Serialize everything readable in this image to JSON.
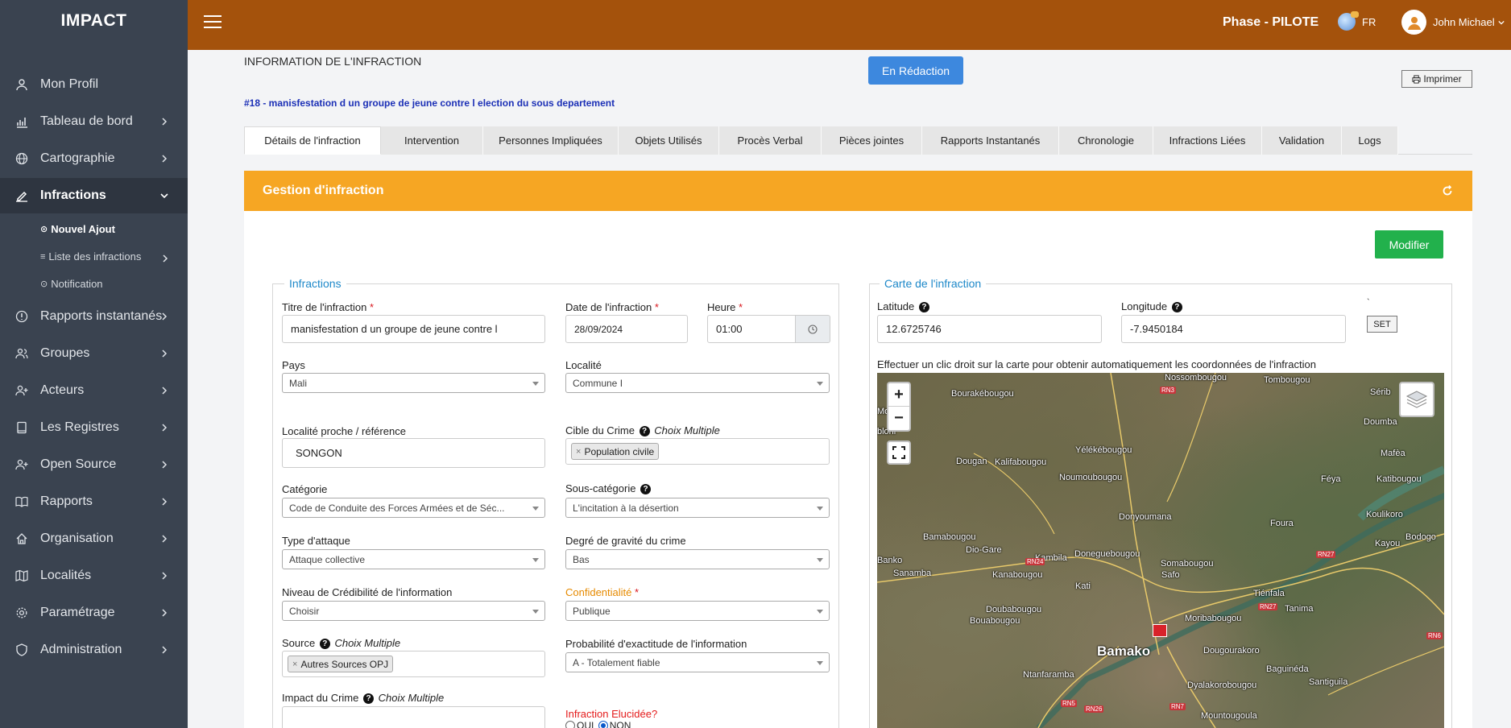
{
  "app": {
    "brand": "IMPACT"
  },
  "sidebar": {
    "items": [
      {
        "label": "Mon Profil",
        "icon": "user-icon",
        "chevron": false
      },
      {
        "label": "Tableau de bord",
        "icon": "bar-chart-icon",
        "chevron": true
      },
      {
        "label": "Cartographie",
        "icon": "globe-icon",
        "chevron": true
      },
      {
        "label": "Infractions",
        "icon": "edit-icon",
        "chevron": true,
        "active": true
      },
      {
        "label": "Rapports instantanés",
        "icon": "alert-circle-icon",
        "chevron": true
      },
      {
        "label": "Groupes",
        "icon": "users-icon",
        "chevron": true
      },
      {
        "label": "Acteurs",
        "icon": "user-plus-icon",
        "chevron": true
      },
      {
        "label": "Les Registres",
        "icon": "book-icon",
        "chevron": true
      },
      {
        "label": "Open Source",
        "icon": "user-plus-icon",
        "chevron": true
      },
      {
        "label": "Rapports",
        "icon": "open-book-icon",
        "chevron": true
      },
      {
        "label": "Organisation",
        "icon": "home-icon",
        "chevron": true
      },
      {
        "label": "Localités",
        "icon": "map-icon",
        "chevron": true
      },
      {
        "label": "Paramétrage",
        "icon": "gear-icon",
        "chevron": true
      },
      {
        "label": "Administration",
        "icon": "shield-icon",
        "chevron": true
      }
    ],
    "subitems": [
      {
        "label": "Nouvel Ajout",
        "icon": "⊙"
      },
      {
        "label": "Liste des infractions",
        "icon": "≡"
      },
      {
        "label": "Notification",
        "icon": "⊙"
      }
    ]
  },
  "topbar": {
    "phase": "Phase - PILOTE",
    "lang": "FR",
    "user": "John Michael"
  },
  "page": {
    "section_title": "INFORMATION DE L'INFRACTION",
    "status_button": "En Rédaction",
    "print_button": "Imprimer",
    "reference": "#18 - manisfestation d un groupe de jeune contre l election du sous departement"
  },
  "tabs": [
    "Détails de l'infraction",
    "Intervention",
    "Personnes Impliquées",
    "Objets Utilisés",
    "Procès Verbal",
    "Pièces jointes",
    "Rapports Instantanés",
    "Chronologie",
    "Infractions Liées",
    "Validation",
    "Logs"
  ],
  "panel": {
    "title": "Gestion d'infraction",
    "modify_button": "Modifier"
  },
  "form": {
    "legend": "Infractions",
    "titre_label": "Titre de l'infraction",
    "titre_value": "manisfestation d un groupe de jeune contre l",
    "date_label": "Date de l'infraction",
    "date_value": "28/09/2024",
    "heure_label": "Heure",
    "heure_value": "01:00",
    "pays_label": "Pays",
    "pays_value": "Mali",
    "localite_label": "Localité",
    "localite_value": "Commune I",
    "proche_label": "Localité proche / référence",
    "proche_value": "SONGON",
    "cible_label": "Cible du Crime",
    "multiple": "Choix Multiple",
    "cible_tag": "Population civile",
    "categorie_label": "Catégorie",
    "categorie_value": "Code de Conduite des Forces Armées et de Séc...",
    "souscat_label": "Sous-catégorie",
    "souscat_value": "L'incitation à la désertion",
    "attaque_label": "Type d'attaque",
    "attaque_value": "Attaque collective",
    "gravite_label": "Degré de gravité du crime",
    "gravite_value": "Bas",
    "credibilite_label": "Niveau de Crédibilité de l'information",
    "credibilite_value": "Choisir",
    "confidentialite_label": "Confidentialité",
    "confidentialite_value": "Publique",
    "source_label": "Source",
    "source_tag": "Autres Sources OPJ",
    "probabilite_label": "Probabilité d'exactitude de l'information",
    "probabilite_value": "A - Totalement fiable",
    "impact_label": "Impact du Crime",
    "elucidee_label": "Infraction Elucidée?",
    "oui": "OUI",
    "non": "NON"
  },
  "map_section": {
    "legend": "Carte de l'infraction",
    "lat_label": "Latitude",
    "lat_value": "12.6725746",
    "lon_label": "Longitude",
    "lon_value": "-7.9450184",
    "tick": "`",
    "set_button": "SET",
    "hint": "Effectuer un clic droit sur la carte pour obtenir automatiquement les coordonnées de l'infraction",
    "zoom_in": "+",
    "zoom_out": "−",
    "places": [
      "Nossombougou",
      "Tombougou",
      "Bourakébougou",
      "Sérib",
      "Doumba",
      "Yélékébougou",
      "Mafèa",
      "Dougan",
      "Kalifabougou",
      "Noumoubougou",
      "Féya",
      "Katibougou",
      "Koulikoro",
      "Bodogo",
      "Kayou",
      "Donyoumana",
      "Foura",
      "Bamabougou",
      "Dio-Gare",
      "Kambila",
      "Doneguebougou",
      "Somabougou",
      "Banko",
      "Sanamba",
      "Kanabougou",
      "Safo",
      "Kati",
      "Tiénfala",
      "Tanima",
      "Doubabougou",
      "Bouabougou",
      "Moribabougou",
      "Bamako",
      "Dougourakoro",
      "Baguinéda",
      "Ntanfaramba",
      "Dyalakorobougou",
      "Santiguila",
      "Mountougoula",
      "Mo",
      "bloni"
    ],
    "roads": [
      "RN3",
      "RN24",
      "RN27",
      "RN27",
      "RN6",
      "RN5",
      "RN26",
      "RN7"
    ]
  }
}
